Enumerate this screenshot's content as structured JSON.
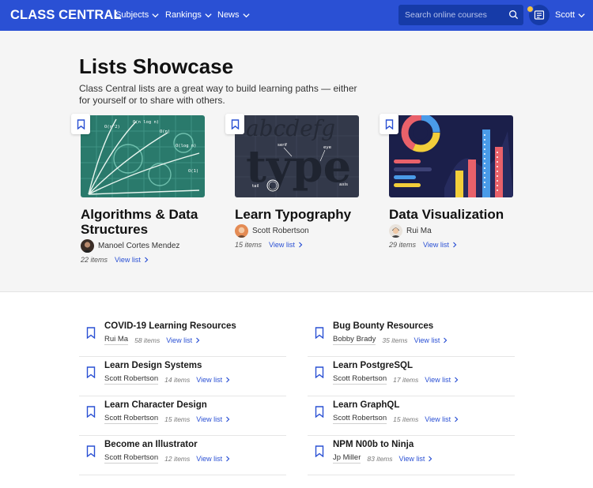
{
  "nav": {
    "logo": "CLASS CENTRAL",
    "menu": [
      {
        "label": "Subjects"
      },
      {
        "label": "Rankings"
      },
      {
        "label": "News"
      }
    ],
    "search_placeholder": "Search online courses",
    "user": "Scott"
  },
  "showcase": {
    "title": "Lists Showcase",
    "subtitle": "Class Central lists are a great way to build learning paths — either for yourself or to share with others.",
    "cards": [
      {
        "title": "Algorithms & Data Structures",
        "author": "Manoel Cortes Mendez",
        "count": "22 items",
        "view": "View list",
        "thumb_labels": [
          "O(n^2)",
          "O(n log n)",
          "O(n)",
          "O(log n)",
          "O(1)"
        ]
      },
      {
        "title": "Learn Typography",
        "author": "Scott Robertson",
        "count": "15 items",
        "view": "View list",
        "thumb_labels": [
          "abcdefg",
          "type",
          "serif",
          "eye",
          "tail",
          "axis"
        ]
      },
      {
        "title": "Data Visualization",
        "author": "Rui Ma",
        "count": "29 items",
        "view": "View list"
      }
    ]
  },
  "lists": [
    {
      "title": "COVID-19 Learning Resources",
      "author": "Rui Ma",
      "count": "58 items",
      "view": "View list"
    },
    {
      "title": "Bug Bounty Resources",
      "author": "Bobby Brady",
      "count": "35 items",
      "view": "View list"
    },
    {
      "title": "Learn Design Systems",
      "author": "Scott Robertson",
      "count": "14 items",
      "view": "View list"
    },
    {
      "title": "Learn PostgreSQL",
      "author": "Scott Robertson",
      "count": "17 items",
      "view": "View list"
    },
    {
      "title": "Learn Character Design",
      "author": "Scott Robertson",
      "count": "15 items",
      "view": "View list"
    },
    {
      "title": "Learn GraphQL",
      "author": "Scott Robertson",
      "count": "15 items",
      "view": "View list"
    },
    {
      "title": "Become an Illustrator",
      "author": "Scott Robertson",
      "count": "12 items",
      "view": "View list"
    },
    {
      "title": "NPM N00b to Ninja",
      "author": "Jp Miller",
      "count": "83 items",
      "view": "View list"
    }
  ],
  "colors": {
    "brand": "#2a50d4",
    "brand_dark": "#163ba8"
  }
}
